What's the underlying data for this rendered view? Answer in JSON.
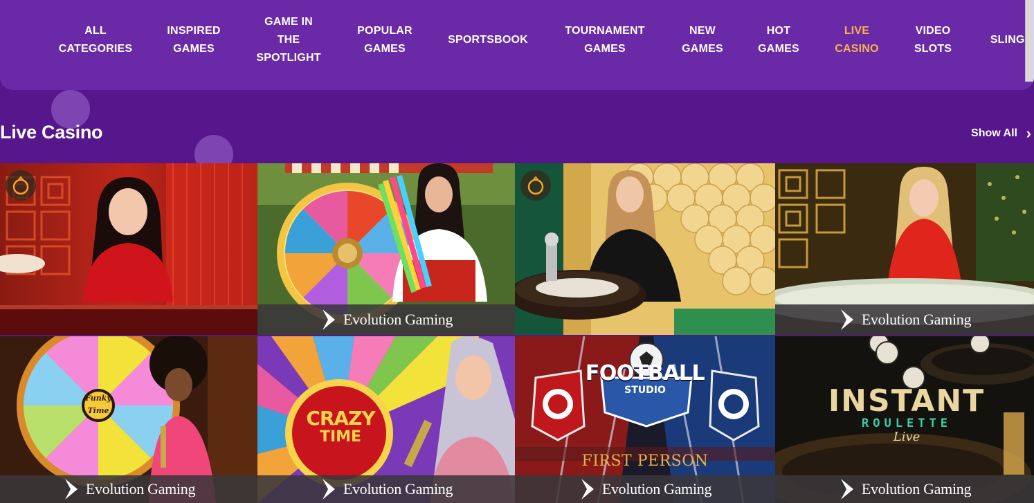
{
  "nav": {
    "items": [
      {
        "label": "ALL\nCATEGORIES",
        "active": false
      },
      {
        "label": "INSPIRED\nGAMES",
        "active": false
      },
      {
        "label": "GAME IN\nTHE\nSPOTLIGHT",
        "active": false
      },
      {
        "label": "POPULAR\nGAMES",
        "active": false
      },
      {
        "label": "SPORTSBOOK",
        "active": false
      },
      {
        "label": "TOURNAMENT\nGAMES",
        "active": false
      },
      {
        "label": "NEW\nGAMES",
        "active": false
      },
      {
        "label": "HOT\nGAMES",
        "active": false
      },
      {
        "label": "LIVE\nCASINO",
        "active": true
      },
      {
        "label": "VIDEO\nSLOTS",
        "active": false
      },
      {
        "label": "SLINGO",
        "active": false
      }
    ],
    "active_color": "#f7b24a"
  },
  "section": {
    "title": "Live Casino",
    "show_all": "Show All",
    "show_all_icon": "chevron-right-icon"
  },
  "tiles": [
    {
      "provider": "",
      "badge": "pragmatic-play-icon",
      "title_text": ""
    },
    {
      "provider": "Evolution Gaming",
      "badge": "",
      "title_text": ""
    },
    {
      "provider": "",
      "badge": "pragmatic-play-icon",
      "title_text": ""
    },
    {
      "provider": "Evolution Gaming",
      "badge": "",
      "title_text": ""
    },
    {
      "provider": "Evolution Gaming",
      "badge": "",
      "title_text": "Funky Time"
    },
    {
      "provider": "Evolution Gaming",
      "badge": "",
      "title_text": "CRAZY TIME"
    },
    {
      "provider": "Evolution Gaming",
      "badge": "",
      "title_text": "FOOTBALL STUDIO"
    },
    {
      "provider": "Evolution Gaming",
      "badge": "",
      "title_text": "INSTANT ROULETTE"
    }
  ],
  "tile_art_text": {
    "football_sub": "STUDIO",
    "football_first_person": "FIRST PERSON",
    "football_score_left": "0",
    "football_score_right": "0",
    "instant_sub": "ROULETTE",
    "instant_live": "Live",
    "crazy_line2": "TIME",
    "funky_line2": "Time"
  },
  "colors": {
    "background": "#56168c",
    "nav_bg": "#6a2aa8",
    "accent": "#f7b24a"
  }
}
